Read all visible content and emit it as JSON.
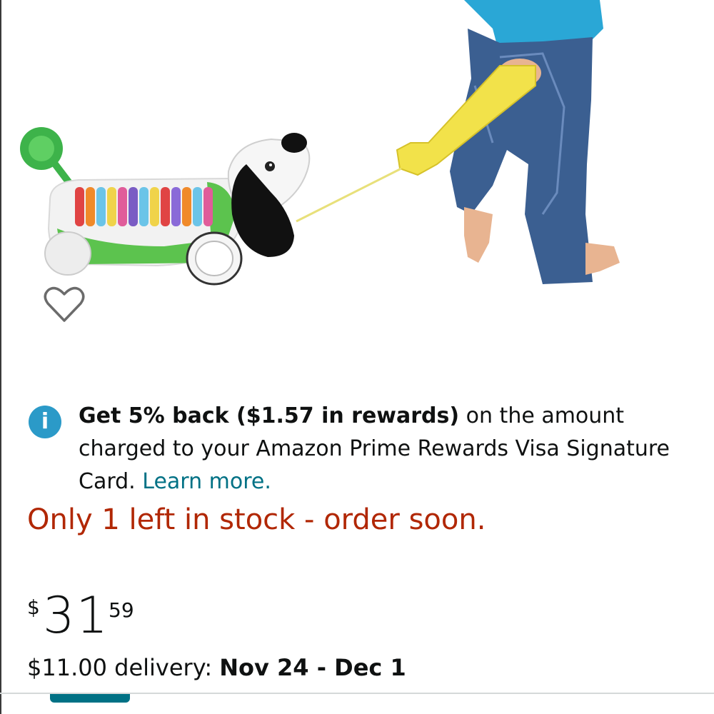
{
  "product": {
    "image_icon": "toy-dog-pull-toy-image",
    "wishlist_icon": "heart-outline-icon"
  },
  "rewards": {
    "icon": "info-icon",
    "icon_glyph": "i",
    "bold_text": "Get 5% back ($1.57 in rewards)",
    "text_1": " on the amount charged to your Amazon Prime Rewards Visa Signature Card. ",
    "link_text": "Learn more.",
    "link_color": "#007185",
    "icon_color": "#2b9ac8"
  },
  "stock": {
    "message": "Only 1 left in stock - order soon.",
    "color": "#b12704"
  },
  "price": {
    "symbol": "$",
    "whole": "31",
    "fraction": "59"
  },
  "delivery": {
    "prefix": "$11.00 delivery: ",
    "dates": "Nov 24 - Dec 1"
  },
  "colors": {
    "accent": "#007185",
    "text": "#0f1111"
  }
}
